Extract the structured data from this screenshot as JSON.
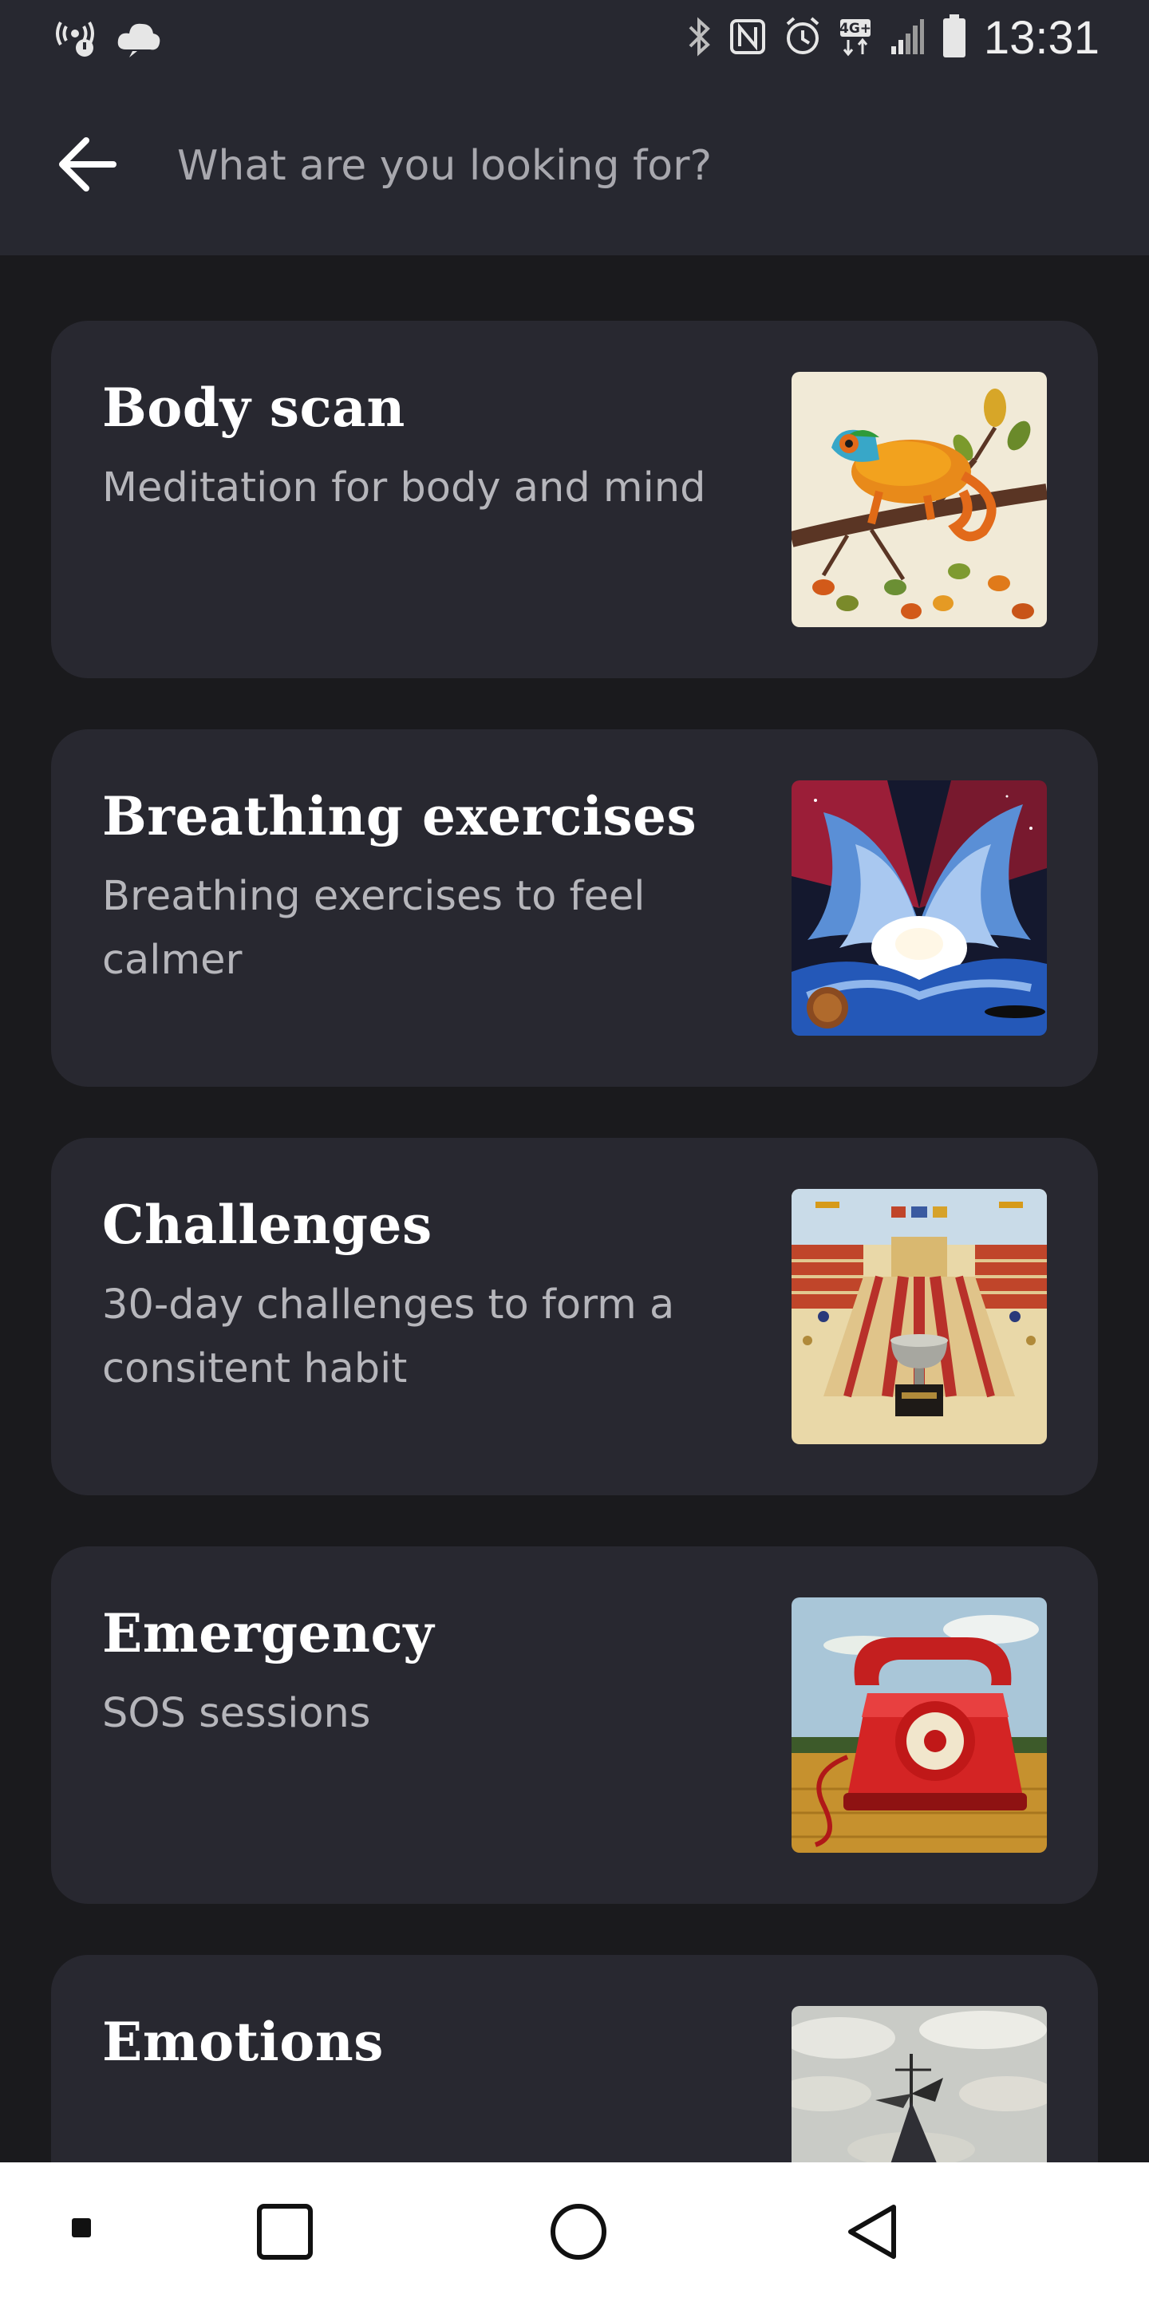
{
  "status_bar": {
    "time": "13:31",
    "left_icons": [
      "wifi-calling-icon",
      "cloud-icon"
    ],
    "right_icons": [
      "bluetooth-icon",
      "nfc-icon",
      "alarm-icon",
      "network-4g-icon",
      "signal-icon",
      "battery-icon"
    ]
  },
  "search": {
    "placeholder": "What are you looking for?",
    "value": ""
  },
  "cards": [
    {
      "title": "Body scan",
      "subtitle": "Meditation for body and mind",
      "image": "chameleon-illustration"
    },
    {
      "title": "Breathing exercises",
      "subtitle": "Breathing exercises to feel calmer",
      "image": "cosmic-cloud-illustration"
    },
    {
      "title": "Challenges",
      "subtitle": "30-day challenges to form a consitent habit",
      "image": "stadium-trophy-illustration"
    },
    {
      "title": "Emergency",
      "subtitle": "SOS sessions",
      "image": "red-telephone-illustration"
    },
    {
      "title": "Emotions",
      "subtitle": "",
      "image": "weathervane-clouds-illustration"
    }
  ],
  "colors": {
    "background": "#1a1a1d",
    "card": "#282830",
    "header": "#272830",
    "title": "#ffffff",
    "subtitle": "#b6b6bb",
    "nav_bar": "#ffffff"
  }
}
